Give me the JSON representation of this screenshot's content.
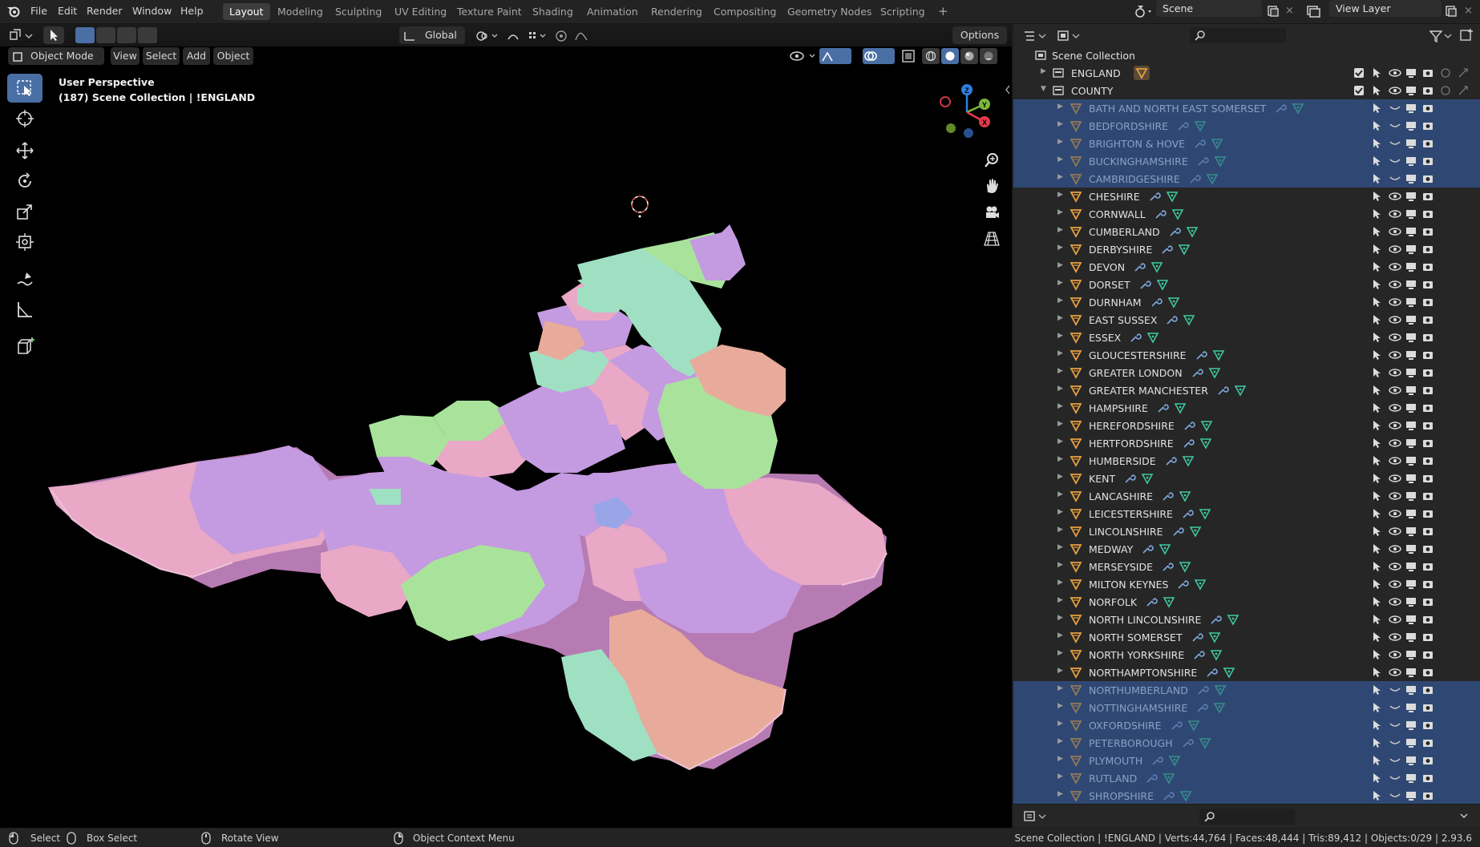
{
  "topbar": {
    "menus": [
      "File",
      "Edit",
      "Render",
      "Window",
      "Help"
    ],
    "workspaces": [
      "Layout",
      "Modeling",
      "Sculpting",
      "UV Editing",
      "Texture Paint",
      "Shading",
      "Animation",
      "Rendering",
      "Compositing",
      "Geometry Nodes",
      "Scripting"
    ],
    "active_workspace": "Layout",
    "add_workspace": "+",
    "scene_name": "Scene",
    "view_layer_name": "View Layer"
  },
  "viewport": {
    "transform_orientation": "Global",
    "options_label": "Options",
    "mode": "Object Mode",
    "menus": [
      "View",
      "Select",
      "Add",
      "Object"
    ],
    "info_line1": "User Perspective",
    "info_line2": "(187) Scene Collection | !ENGLAND",
    "gizmo_axes": {
      "x": "X",
      "y": "Y",
      "z": "Z"
    },
    "colors": {
      "pink": "#e9a8c6",
      "violet": "#c49ae0",
      "mint": "#9fe0c3",
      "green": "#a9e39b",
      "peach": "#e8ab9b",
      "blue": "#98a6e8"
    }
  },
  "outliner": {
    "root": "Scene Collection",
    "collections": [
      {
        "name": "ENGLAND",
        "expanded": false
      },
      {
        "name": "COUNTY",
        "expanded": true
      }
    ],
    "counties": [
      {
        "name": "BATH AND NORTH EAST SOMERSET",
        "selected": true,
        "hidden": true
      },
      {
        "name": "BEDFORDSHIRE",
        "selected": true,
        "hidden": true
      },
      {
        "name": "BRIGHTON & HOVE",
        "selected": true,
        "hidden": true
      },
      {
        "name": "BUCKINGHAMSHIRE",
        "selected": true,
        "hidden": true
      },
      {
        "name": "CAMBRIDGESHIRE",
        "selected": true,
        "hidden": true
      },
      {
        "name": "CHESHIRE",
        "selected": false,
        "hidden": false
      },
      {
        "name": "CORNWALL",
        "selected": false,
        "hidden": false
      },
      {
        "name": "CUMBERLAND",
        "selected": false,
        "hidden": false
      },
      {
        "name": "DERBYSHIRE",
        "selected": false,
        "hidden": false
      },
      {
        "name": "DEVON",
        "selected": false,
        "hidden": false
      },
      {
        "name": "DORSET",
        "selected": false,
        "hidden": false
      },
      {
        "name": "DURNHAM",
        "selected": false,
        "hidden": false
      },
      {
        "name": "EAST SUSSEX",
        "selected": false,
        "hidden": false
      },
      {
        "name": "ESSEX",
        "selected": false,
        "hidden": false
      },
      {
        "name": "GLOUCESTERSHIRE",
        "selected": false,
        "hidden": false
      },
      {
        "name": "GREATER LONDON",
        "selected": false,
        "hidden": false
      },
      {
        "name": "GREATER MANCHESTER",
        "selected": false,
        "hidden": false
      },
      {
        "name": "HAMPSHIRE",
        "selected": false,
        "hidden": false
      },
      {
        "name": "HEREFORDSHIRE",
        "selected": false,
        "hidden": false
      },
      {
        "name": "HERTFORDSHIRE",
        "selected": false,
        "hidden": false
      },
      {
        "name": "HUMBERSIDE",
        "selected": false,
        "hidden": false
      },
      {
        "name": "KENT",
        "selected": false,
        "hidden": false
      },
      {
        "name": "LANCASHIRE",
        "selected": false,
        "hidden": false
      },
      {
        "name": "LEICESTERSHIRE",
        "selected": false,
        "hidden": false
      },
      {
        "name": "LINCOLNSHIRE",
        "selected": false,
        "hidden": false
      },
      {
        "name": "MEDWAY",
        "selected": false,
        "hidden": false
      },
      {
        "name": "MERSEYSIDE",
        "selected": false,
        "hidden": false
      },
      {
        "name": "MILTON KEYNES",
        "selected": false,
        "hidden": false
      },
      {
        "name": "NORFOLK",
        "selected": false,
        "hidden": false
      },
      {
        "name": "NORTH LINCOLNSHIRE",
        "selected": false,
        "hidden": false
      },
      {
        "name": "NORTH SOMERSET",
        "selected": false,
        "hidden": false
      },
      {
        "name": "NORTH YORKSHIRE",
        "selected": false,
        "hidden": false
      },
      {
        "name": "NORTHAMPTONSHIRE",
        "selected": false,
        "hidden": false
      },
      {
        "name": "NORTHUMBERLAND",
        "selected": true,
        "hidden": true
      },
      {
        "name": "NOTTINGHAMSHIRE",
        "selected": true,
        "hidden": true
      },
      {
        "name": "OXFORDSHIRE",
        "selected": true,
        "hidden": true
      },
      {
        "name": "PETERBOROUGH",
        "selected": true,
        "hidden": true
      },
      {
        "name": "PLYMOUTH",
        "selected": true,
        "hidden": true
      },
      {
        "name": "RUTLAND",
        "selected": true,
        "hidden": true
      },
      {
        "name": "SHROPSHIRE",
        "selected": true,
        "hidden": true
      }
    ]
  },
  "statusbar": {
    "select": "Select",
    "box_select": "Box Select",
    "rotate_view": "Rotate View",
    "context_menu": "Object Context Menu",
    "stats": "Scene Collection | !ENGLAND | Verts:44,764 | Faces:48,444 | Tris:89,412 | Objects:0/29 | 2.93.6"
  }
}
